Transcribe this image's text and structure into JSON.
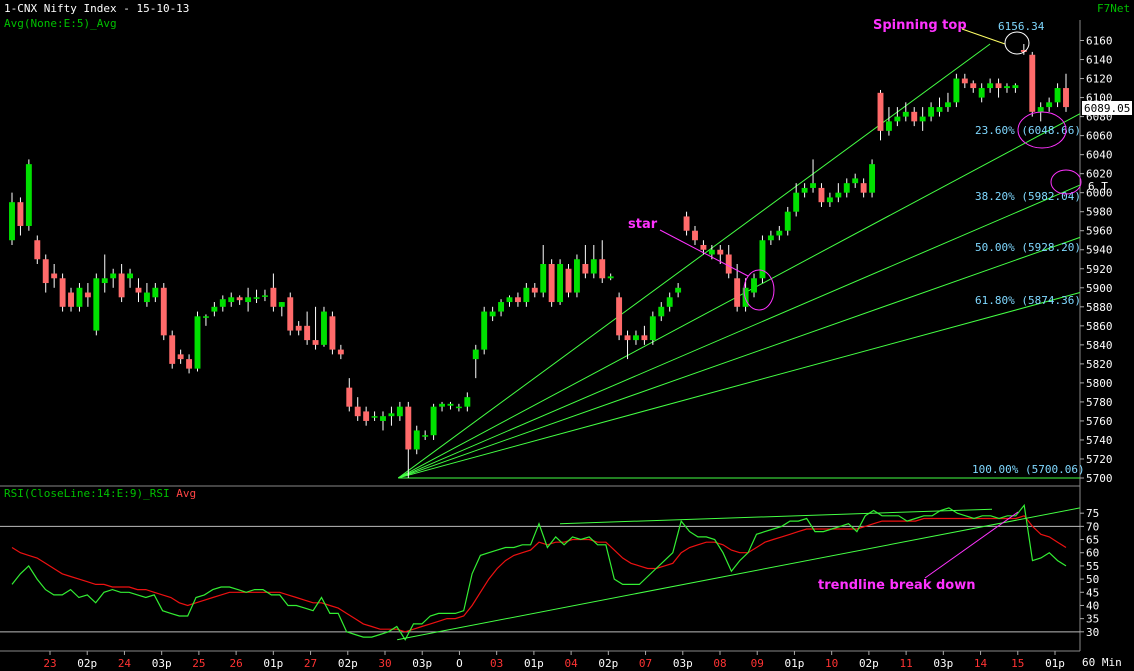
{
  "header": {
    "title": "1-CNX Nifty Index - 15-10-13",
    "indicator": "Avg(None:E:5)_Avg",
    "brand": "F7Net",
    "rsi_label": "RSI(CloseLine:14:E:9)_RSI",
    "rsi_avg": "Avg",
    "interval": "60 Min"
  },
  "colors": {
    "up": "#00e000",
    "down": "#ff6a6a",
    "green_text": "#00c000",
    "grid": "#6b6b6b",
    "annotation": "#ff33ff",
    "fib_text": "#7fd8ff",
    "rsi_line": "#33ee33",
    "rsi_avg_line": "#ee1111",
    "fan_line": "#44ff44"
  },
  "annotations": {
    "spinning_top": "Spinning top",
    "star": "star",
    "trendline": "trendline break down"
  },
  "chart_data": [
    {
      "type": "candlestick",
      "ylim": [
        5700,
        6170
      ],
      "yticks": [
        5700,
        5720,
        5740,
        5760,
        5780,
        5800,
        5820,
        5840,
        5860,
        5880,
        5900,
        5920,
        5940,
        5960,
        5980,
        6000,
        6020,
        6040,
        6060,
        6080,
        6100,
        6120,
        6140,
        6160
      ],
      "x_labels": [
        "23",
        "02p",
        "24",
        "03p",
        "25",
        "26",
        "01p",
        "27",
        "02p",
        "30",
        "03p",
        "O",
        "03",
        "01p",
        "04",
        "02p",
        "07",
        "03p",
        "08",
        "09",
        "01p",
        "10",
        "02p",
        "11",
        "03p",
        "14",
        "15",
        "01p"
      ],
      "x_label_colors": [
        "red",
        "white",
        "red",
        "white",
        "red",
        "red",
        "white",
        "red",
        "white",
        "red",
        "white",
        "white",
        "red",
        "white",
        "red",
        "white",
        "red",
        "white",
        "red",
        "red",
        "white",
        "red",
        "white",
        "red",
        "white",
        "red",
        "red",
        "white"
      ],
      "last_price": "6089.05",
      "high_label": "6156.34",
      "fib_levels": [
        {
          "label": "23.60% (6048.66)",
          "value": 6048.66
        },
        {
          "label": "38.20% (5982.04)",
          "value": 5982.04
        },
        {
          "label": "50.00% (5928.20)",
          "value": 5928.2
        },
        {
          "label": "61.80% (5874.36)",
          "value": 5874.36
        },
        {
          "label": "100.00% (5700.06)",
          "value": 5700.06
        }
      ],
      "partial_label": "6 T",
      "candles": [
        [
          5950,
          5990,
          5945,
          6000
        ],
        [
          5990,
          5965,
          5955,
          5995
        ],
        [
          5965,
          6030,
          5960,
          6035
        ],
        [
          5950,
          5930,
          5925,
          5955
        ],
        [
          5930,
          5905,
          5895,
          5935
        ],
        [
          5915,
          5910,
          5900,
          5925
        ],
        [
          5910,
          5880,
          5875,
          5915
        ],
        [
          5895,
          5880,
          5875,
          5900
        ],
        [
          5880,
          5900,
          5875,
          5905
        ],
        [
          5895,
          5890,
          5880,
          5905
        ],
        [
          5855,
          5910,
          5850,
          5915
        ],
        [
          5905,
          5910,
          5895,
          5935
        ],
        [
          5910,
          5915,
          5900,
          5920
        ],
        [
          5915,
          5890,
          5885,
          5925
        ],
        [
          5910,
          5915,
          5900,
          5920
        ],
        [
          5900,
          5895,
          5885,
          5910
        ],
        [
          5885,
          5895,
          5880,
          5905
        ],
        [
          5890,
          5900,
          5885,
          5905
        ],
        [
          5900,
          5850,
          5845,
          5905
        ],
        [
          5850,
          5820,
          5815,
          5855
        ],
        [
          5830,
          5825,
          5820,
          5835
        ],
        [
          5825,
          5815,
          5810,
          5830
        ],
        [
          5815,
          5870,
          5812,
          5875
        ],
        [
          5870,
          5870,
          5860,
          5872
        ],
        [
          5875,
          5880,
          5870,
          5885
        ],
        [
          5880,
          5888,
          5875,
          5892
        ],
        [
          5885,
          5890,
          5880,
          5895
        ],
        [
          5890,
          5887,
          5882,
          5892
        ],
        [
          5885,
          5890,
          5875,
          5900
        ],
        [
          5890,
          5890,
          5884,
          5898
        ],
        [
          5892,
          5892,
          5886,
          5898
        ],
        [
          5900,
          5880,
          5875,
          5915
        ],
        [
          5880,
          5885,
          5870,
          5885
        ],
        [
          5890,
          5855,
          5850,
          5895
        ],
        [
          5860,
          5855,
          5850,
          5865
        ],
        [
          5860,
          5845,
          5840,
          5875
        ],
        [
          5845,
          5840,
          5835,
          5880
        ],
        [
          5840,
          5875,
          5838,
          5880
        ],
        [
          5870,
          5835,
          5830,
          5875
        ],
        [
          5835,
          5830,
          5825,
          5840
        ],
        [
          5795,
          5775,
          5770,
          5805
        ],
        [
          5775,
          5765,
          5760,
          5785
        ],
        [
          5770,
          5760,
          5755,
          5775
        ],
        [
          5765,
          5765,
          5760,
          5770
        ],
        [
          5760,
          5765,
          5750,
          5770
        ],
        [
          5765,
          5768,
          5755,
          5775
        ],
        [
          5765,
          5775,
          5760,
          5780
        ],
        [
          5775,
          5730,
          5700,
          5780
        ],
        [
          5730,
          5750,
          5725,
          5755
        ],
        [
          5745,
          5745,
          5740,
          5750
        ],
        [
          5745,
          5775,
          5740,
          5778
        ],
        [
          5775,
          5778,
          5770,
          5780
        ],
        [
          5776,
          5778,
          5772,
          5780
        ],
        [
          5775,
          5775,
          5770,
          5778
        ],
        [
          5775,
          5785,
          5770,
          5790
        ],
        [
          5825,
          5835,
          5805,
          5840
        ],
        [
          5835,
          5875,
          5830,
          5880
        ],
        [
          5870,
          5875,
          5865,
          5880
        ],
        [
          5875,
          5885,
          5870,
          5888
        ],
        [
          5885,
          5890,
          5880,
          5892
        ],
        [
          5890,
          5885,
          5880,
          5895
        ],
        [
          5885,
          5900,
          5880,
          5905
        ],
        [
          5900,
          5895,
          5890,
          5905
        ],
        [
          5895,
          5925,
          5890,
          5945
        ],
        [
          5925,
          5885,
          5880,
          5930
        ],
        [
          5885,
          5925,
          5882,
          5930
        ],
        [
          5920,
          5895,
          5890,
          5925
        ],
        [
          5895,
          5930,
          5890,
          5935
        ],
        [
          5925,
          5915,
          5910,
          5945
        ],
        [
          5915,
          5930,
          5910,
          5945
        ],
        [
          5930,
          5910,
          5905,
          5950
        ],
        [
          5910,
          5912,
          5908,
          5915
        ],
        [
          5890,
          5850,
          5845,
          5895
        ],
        [
          5850,
          5845,
          5825,
          5855
        ],
        [
          5845,
          5850,
          5840,
          5855
        ],
        [
          5850,
          5845,
          5840,
          5860
        ],
        [
          5845,
          5870,
          5840,
          5875
        ],
        [
          5870,
          5880,
          5865,
          5885
        ],
        [
          5880,
          5890,
          5875,
          5895
        ],
        [
          5895,
          5900,
          5890,
          5905
        ],
        [
          5975,
          5960,
          5955,
          5980
        ],
        [
          5960,
          5950,
          5945,
          5965
        ],
        [
          5945,
          5940,
          5935,
          5950
        ],
        [
          5935,
          5940,
          5930,
          5945
        ],
        [
          5940,
          5935,
          5925,
          5945
        ],
        [
          5935,
          5915,
          5910,
          5945
        ],
        [
          5910,
          5880,
          5875,
          5925
        ],
        [
          5880,
          5900,
          5875,
          5910
        ],
        [
          5895,
          5910,
          5890,
          5915
        ],
        [
          5910,
          5950,
          5905,
          5955
        ],
        [
          5950,
          5955,
          5945,
          5960
        ],
        [
          5955,
          5960,
          5950,
          5965
        ],
        [
          5960,
          5980,
          5955,
          5985
        ],
        [
          5980,
          6000,
          5975,
          6010
        ],
        [
          6000,
          6005,
          5995,
          6010
        ],
        [
          6005,
          6010,
          6000,
          6035
        ],
        [
          6005,
          5990,
          5985,
          6010
        ],
        [
          5990,
          5995,
          5985,
          6000
        ],
        [
          5995,
          6000,
          5990,
          6010
        ],
        [
          6000,
          6010,
          5995,
          6015
        ],
        [
          6010,
          6015,
          6005,
          6020
        ],
        [
          6010,
          6000,
          5995,
          6015
        ],
        [
          6000,
          6030,
          5995,
          6035
        ],
        [
          6105,
          6065,
          6055,
          6108
        ],
        [
          6065,
          6075,
          6060,
          6090
        ],
        [
          6075,
          6080,
          6070,
          6090
        ],
        [
          6080,
          6085,
          6075,
          6095
        ],
        [
          6085,
          6075,
          6070,
          6090
        ],
        [
          6075,
          6080,
          6065,
          6090
        ],
        [
          6080,
          6090,
          6075,
          6095
        ],
        [
          6085,
          6090,
          6080,
          6100
        ],
        [
          6090,
          6095,
          6085,
          6105
        ],
        [
          6095,
          6120,
          6090,
          6125
        ],
        [
          6120,
          6115,
          6110,
          6125
        ],
        [
          6115,
          6110,
          6105,
          6118
        ],
        [
          6100,
          6110,
          6095,
          6115
        ],
        [
          6110,
          6115,
          6105,
          6120
        ],
        [
          6115,
          6110,
          6100,
          6120
        ],
        [
          6110,
          6112,
          6105,
          6115
        ],
        [
          6110,
          6113,
          6105,
          6115
        ],
        [
          6150,
          6148,
          6145,
          6156.34
        ],
        [
          6145,
          6085,
          6080,
          6148
        ],
        [
          6085,
          6090,
          6075,
          6095
        ],
        [
          6090,
          6095,
          6085,
          6100
        ],
        [
          6095,
          6110,
          6090,
          6115
        ],
        [
          6110,
          6090,
          6085,
          6125
        ]
      ]
    },
    {
      "type": "line",
      "title": "RSI(CloseLine:14:E:9)_RSI",
      "ylim": [
        25,
        80
      ],
      "yticks": [
        30,
        35,
        40,
        45,
        50,
        55,
        60,
        65,
        70,
        75
      ],
      "series": [
        {
          "name": "RSI",
          "values": [
            48,
            52,
            55,
            50,
            46,
            44,
            44,
            46,
            43,
            44,
            41,
            45,
            46,
            45,
            45,
            44,
            43,
            44,
            38,
            37,
            36,
            36,
            43,
            44,
            46,
            47,
            47,
            46,
            45,
            46,
            46,
            44,
            44,
            40,
            40,
            39,
            38,
            43,
            37,
            37,
            30,
            29,
            28,
            28,
            29,
            30,
            32,
            27,
            33,
            33,
            36,
            37,
            37,
            37,
            38,
            52,
            59,
            60,
            61,
            62,
            62,
            63,
            63,
            71,
            62,
            66,
            63,
            66,
            65,
            66,
            63,
            63,
            50,
            48,
            48,
            48,
            51,
            54,
            57,
            60,
            72,
            68,
            66,
            66,
            65,
            60,
            53,
            57,
            60,
            67,
            68,
            69,
            70,
            72,
            72,
            73,
            68,
            68,
            69,
            70,
            71,
            68,
            74,
            76,
            74,
            74,
            74,
            72,
            73,
            74,
            74,
            76,
            77,
            75,
            74,
            73,
            74,
            74,
            73,
            74,
            74,
            78,
            57,
            58,
            60,
            57,
            55
          ]
        },
        {
          "name": "Avg",
          "values": [
            62,
            60,
            59,
            58,
            56,
            54,
            52,
            51,
            50,
            49,
            48,
            48,
            47,
            47,
            47,
            46,
            46,
            45,
            44,
            43,
            41,
            40,
            41,
            42,
            43,
            44,
            45,
            45,
            45,
            45,
            45,
            45,
            45,
            44,
            43,
            42,
            41,
            41,
            40,
            39,
            37,
            35,
            33,
            32,
            31,
            31,
            31,
            30,
            31,
            32,
            33,
            34,
            35,
            35,
            36,
            40,
            45,
            50,
            54,
            57,
            59,
            60,
            61,
            64,
            63,
            64,
            64,
            65,
            65,
            65,
            64,
            64,
            61,
            58,
            56,
            55,
            54,
            54,
            55,
            56,
            60,
            62,
            63,
            64,
            64,
            63,
            61,
            60,
            60,
            62,
            64,
            65,
            66,
            67,
            68,
            69,
            69,
            69,
            69,
            69,
            69,
            69,
            70,
            71,
            72,
            72,
            72,
            72,
            72,
            73,
            73,
            73,
            73,
            73,
            73,
            73,
            73,
            73,
            73,
            73,
            73,
            74,
            70,
            67,
            66,
            64,
            62
          ]
        }
      ],
      "legend": "top-left"
    }
  ]
}
